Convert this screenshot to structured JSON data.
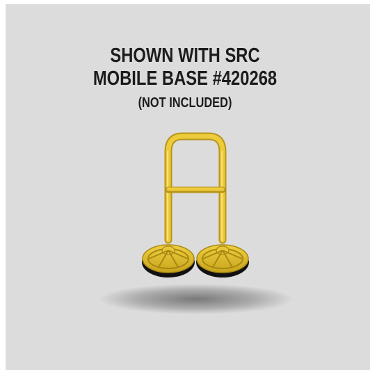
{
  "caption": {
    "line1": "SHOWN WITH SRC",
    "line2": "MOBILE BASE #420268",
    "line3": "(NOT INCLUDED)"
  },
  "colors": {
    "background": "#dcdcdc",
    "text": "#1c1c1c",
    "frame_yellow": "#e2c02c",
    "frame_yellow_dark": "#b89412",
    "tire": "#111111"
  },
  "image": {
    "subject": "yellow mobile base cart frame with two wheels",
    "icon": "mobile-base-cart"
  }
}
